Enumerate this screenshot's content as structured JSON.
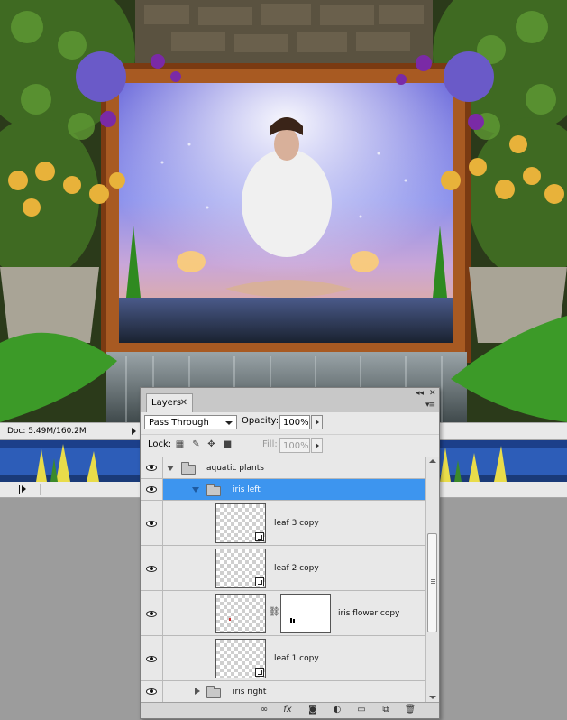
{
  "status_bar": {
    "doc_info": "Doc: 5.49M/160.2M"
  },
  "layers_panel": {
    "tab_label": "Layers",
    "blend_mode": "Pass Through",
    "opacity_label": "Opacity:",
    "opacity_value": "100%",
    "lock_label": "Lock:",
    "fill_label": "Fill:",
    "fill_value": "100%",
    "layers": [
      {
        "name": "aquatic plants",
        "type": "group",
        "expanded": true,
        "selected": false
      },
      {
        "name": "iris left",
        "type": "group",
        "expanded": true,
        "selected": true
      },
      {
        "name": "leaf 3 copy",
        "type": "smart-object"
      },
      {
        "name": "leaf 2 copy",
        "type": "smart-object"
      },
      {
        "name": "iris flower copy",
        "type": "smart-object-with-mask"
      },
      {
        "name": "leaf 1 copy",
        "type": "smart-object"
      },
      {
        "name": "iris right",
        "type": "group",
        "expanded": false,
        "selected": false
      }
    ],
    "bottom_icons": [
      "link-icon",
      "fx-icon",
      "mask-icon",
      "adjustment-icon",
      "new-group-icon",
      "new-layer-icon",
      "trash-icon"
    ]
  },
  "colors": {
    "selection": "#3d95ef",
    "panel_bg": "#e8e8e8",
    "canvas_bg": "#9c9c9c"
  }
}
